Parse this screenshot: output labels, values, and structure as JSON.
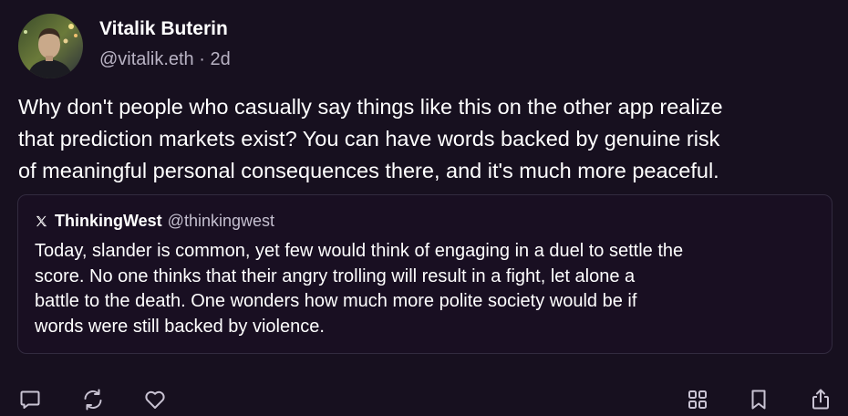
{
  "post": {
    "author": {
      "name": "Vitalik Buterin",
      "handle": "@vitalik.eth",
      "separator": "·",
      "time": "2d"
    },
    "text_lines": [
      "Why don't people who casually say things like this on the other app realize",
      "that prediction markets exist? You can have words backed by genuine risk",
      "of meaningful personal consequences there, and it's much more peaceful."
    ]
  },
  "quote": {
    "source_icon": "x-logo-icon",
    "author_name": "ThinkingWest",
    "author_handle": "@thinkingwest",
    "text_lines": [
      "Today, slander is common, yet few would think of engaging in a duel to settle the",
      "score. No one thinks that their angry trolling will result in a fight, let alone a",
      "battle to the death. One wonders how much more polite society would be if",
      "words were still backed by violence."
    ]
  },
  "actions": {
    "left": [
      "reply-icon",
      "recast-icon",
      "like-icon"
    ],
    "right": [
      "apps-grid-icon",
      "bookmark-icon",
      "share-icon"
    ]
  },
  "colors": {
    "background": "#17101f",
    "text": "#ffffff",
    "muted": "#b9b3c4",
    "card_border": "#322b3f"
  }
}
